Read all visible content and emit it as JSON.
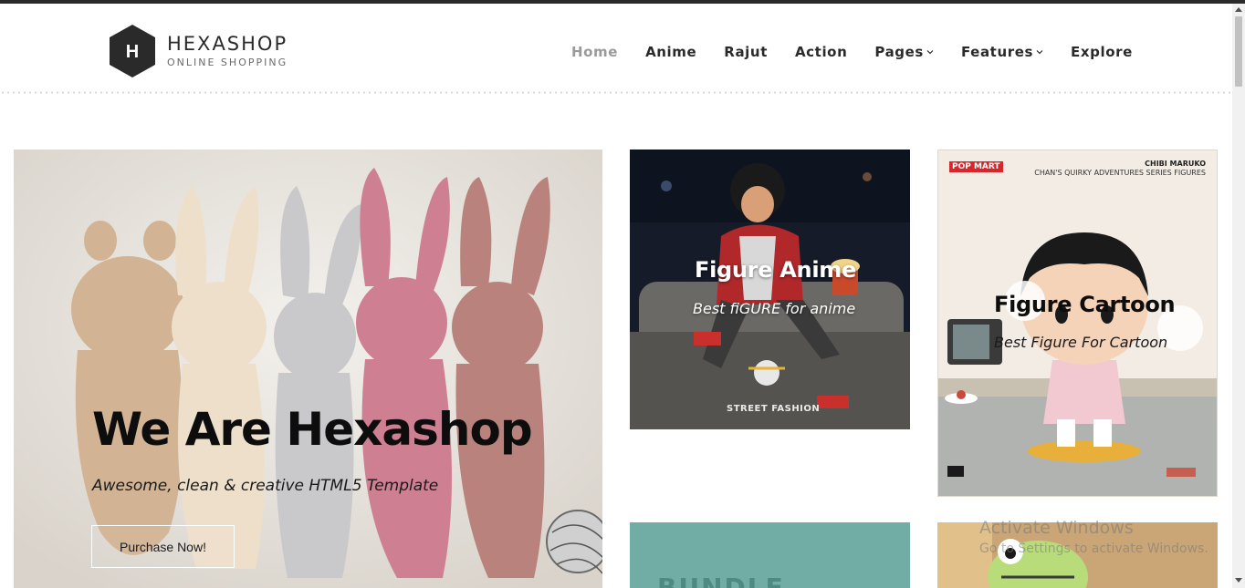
{
  "brand": {
    "logo_letter": "H",
    "name": "HEXASHOP",
    "tagline": "ONLINE SHOPPING"
  },
  "nav": {
    "items": [
      {
        "label": "Home",
        "active": true
      },
      {
        "label": "Anime"
      },
      {
        "label": "Rajut"
      },
      {
        "label": "Action"
      },
      {
        "label": "Pages",
        "dropdown": true
      },
      {
        "label": "Features",
        "dropdown": true
      },
      {
        "label": "Explore"
      }
    ]
  },
  "hero": {
    "title": "We Are Hexashop",
    "subtitle": "Awesome, clean & creative HTML5 Template",
    "button_label": "Purchase Now!"
  },
  "cards": {
    "anime": {
      "title": "Figure Anime",
      "subtitle": "Best fiGURE for anime",
      "image_caption": "STREET FASHION"
    },
    "cartoon": {
      "title": "Figure Cartoon",
      "subtitle": "Best Figure For Cartoon",
      "image_brand": "POP MART",
      "image_heading": "CHIBI MARUKO",
      "image_line": "CHAN'S QUIRKY ADVENTURES SERIES FIGURES"
    },
    "bundle": {
      "image_text": "BUNDLE"
    }
  },
  "watermark": {
    "title": "Activate Windows",
    "subtitle": "Go to Settings to activate Windows."
  },
  "icons": {
    "logo": "hexagon-logo-icon",
    "caret": "chevron-down-icon",
    "scroll_up": "arrow-up-icon",
    "scroll_down": "arrow-down-icon"
  },
  "colors": {
    "text_dark": "#2a2a2a",
    "nav_active": "#9a9a9a",
    "hero_title": "#0d0d0d",
    "popmart_red": "#d8262b"
  }
}
